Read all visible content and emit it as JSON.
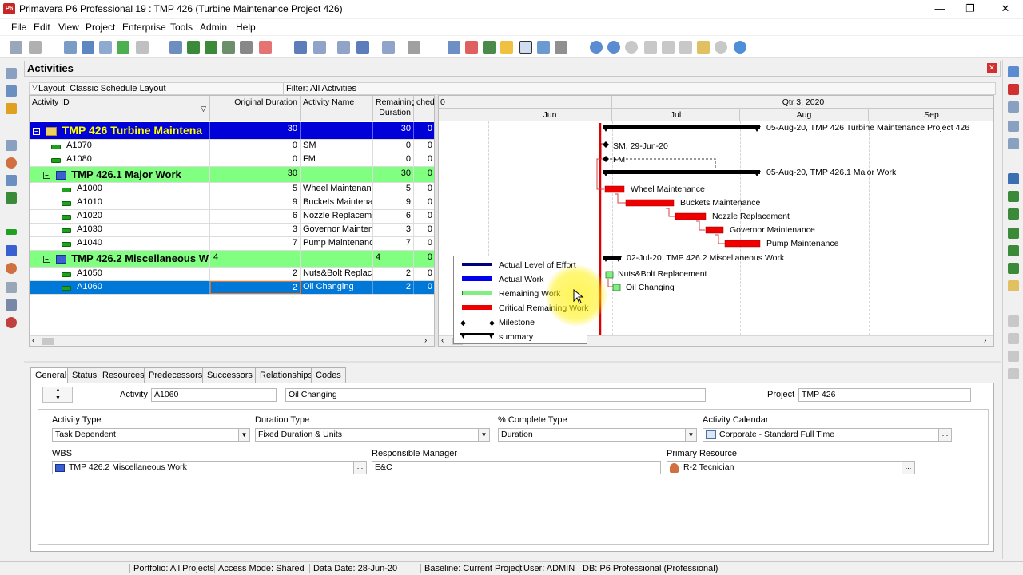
{
  "window": {
    "app_icon": "P6",
    "title": "Primavera P6 Professional 19 : TMP 426 (Turbine Maintenance Project 426)",
    "minimize": "—",
    "restore": "❐",
    "close": "✕"
  },
  "menu": [
    "File",
    "Edit",
    "View",
    "Project",
    "Enterprise",
    "Tools",
    "Admin",
    "Help"
  ],
  "panel": {
    "title": "Activities",
    "close": "✕",
    "layout": "Layout: Classic Schedule Layout",
    "filter": "Filter: All Activities"
  },
  "grid": {
    "headers": {
      "activity_id": "Activity ID",
      "original_duration": "Original Duration",
      "activity_name": "Activity Name",
      "remaining_duration": "Remaining Duration",
      "schedule": "chedu"
    },
    "rows": [
      {
        "kind": "project",
        "toggle": "–",
        "id": "TMP 426  Turbine Maintena",
        "orig": "30",
        "name": "",
        "rem": "30",
        "sched": "0"
      },
      {
        "kind": "activity",
        "id": "A1070",
        "orig": "0",
        "name": "SM",
        "rem": "0",
        "sched": "0"
      },
      {
        "kind": "activity",
        "id": "A1080",
        "orig": "0",
        "name": "FM",
        "rem": "0",
        "sched": "0"
      },
      {
        "kind": "wbs",
        "toggle": "–",
        "id": "TMP 426.1  Major Work",
        "orig": "30",
        "name": "",
        "rem": "30",
        "sched": "0"
      },
      {
        "kind": "activity",
        "id": "A1000",
        "orig": "5",
        "name": "Wheel Maintenanc",
        "rem": "5",
        "sched": "0"
      },
      {
        "kind": "activity",
        "id": "A1010",
        "orig": "9",
        "name": "Buckets Maintenar",
        "rem": "9",
        "sched": "0"
      },
      {
        "kind": "activity",
        "id": "A1020",
        "orig": "6",
        "name": "Nozzle Replaceme",
        "rem": "6",
        "sched": "0"
      },
      {
        "kind": "activity",
        "id": "A1030",
        "orig": "3",
        "name": "Governor Maintena",
        "rem": "3",
        "sched": "0"
      },
      {
        "kind": "activity",
        "id": "A1040",
        "orig": "7",
        "name": "Pump Maintenance",
        "rem": "7",
        "sched": "0"
      },
      {
        "kind": "wbs",
        "toggle": "–",
        "id": "TMP 426.2  Miscellaneous W",
        "orig": "4",
        "name": "",
        "rem": "4",
        "sched": "0"
      },
      {
        "kind": "activity",
        "id": "A1050",
        "orig": "2",
        "name": "Nuts&Bolt Replace",
        "rem": "2",
        "sched": "0"
      },
      {
        "kind": "selected",
        "id": "A1060",
        "orig": "2",
        "name": "Oil Changing",
        "rem": "2",
        "sched": "0"
      }
    ]
  },
  "gantt": {
    "top_left": "0",
    "quarter": "Qtr 3, 2020",
    "months": [
      "Jun",
      "Jul",
      "Aug",
      "Sep"
    ],
    "labels": {
      "project": "05-Aug-20, TMP 426  Turbine Maintenance Project 426",
      "sm": "SM, 29-Jun-20",
      "fm": "FM",
      "wbs1": "05-Aug-20, TMP 426.1  Major Work",
      "a1000": "Wheel Maintenance",
      "a1010": "Buckets Maintenance",
      "a1020": "Nozzle Replacement",
      "a1030": "Governor Maintenance",
      "a1040": "Pump Maintenance",
      "wbs2": "02-Jul-20, TMP 426.2  Miscellaneous Work",
      "a1050": "Nuts&Bolt Replacement",
      "a1060": "Oil Changing"
    },
    "colors": {
      "critical": "#ee0000",
      "remaining": "#80ee80",
      "summary": "#000000",
      "data_date": "#dd0000"
    }
  },
  "legend": [
    {
      "label": "Actual Level of Effort",
      "color": "#000080"
    },
    {
      "label": "Actual Work",
      "color": "#0000ee"
    },
    {
      "label": "Remaining Work",
      "color": "#80ee80"
    },
    {
      "label": "Critical Remaining Work",
      "color": "#ee0000"
    },
    {
      "label": "Milestone",
      "color": "#000000"
    },
    {
      "label": "summary",
      "color": "#000000"
    }
  ],
  "tabs": [
    "General",
    "Status",
    "Resources",
    "Predecessors",
    "Successors",
    "Relationships",
    "Codes"
  ],
  "details": {
    "activity_label": "Activity",
    "activity_id": "A1060",
    "activity_name": "Oil Changing",
    "project_label": "Project",
    "project": "TMP 426",
    "activity_type_label": "Activity Type",
    "activity_type": "Task Dependent",
    "duration_type_label": "Duration Type",
    "duration_type": "Fixed Duration & Units",
    "pct_type_label": "% Complete Type",
    "pct_type": "Duration",
    "calendar_label": "Activity Calendar",
    "calendar": "Corporate - Standard Full Time",
    "wbs_label": "WBS",
    "wbs": "TMP 426.2  Miscellaneous Work",
    "manager_label": "Responsible Manager",
    "manager": "E&C",
    "resource_label": "Primary Resource",
    "resource": "R-2  Tecnician",
    "browse": "..."
  },
  "status": {
    "portfolio": "Portfolio: All Projects",
    "access": "Access Mode: Shared",
    "data_date": "Data Date: 28-Jun-20",
    "baseline": "Baseline: Current Project",
    "user": "User: ADMIN",
    "db": "DB: P6 Professional (Professional)"
  },
  "icons": [
    "app-icon",
    "print-icon",
    "layout-icon",
    "filter-icon",
    "zoom-in-icon",
    "zoom-out-icon",
    "help-icon",
    "folder-icon",
    "gear-icon",
    "chevron-down-icon",
    "expand-icon",
    "activity-bar-icon",
    "wbs-folder-icon"
  ]
}
